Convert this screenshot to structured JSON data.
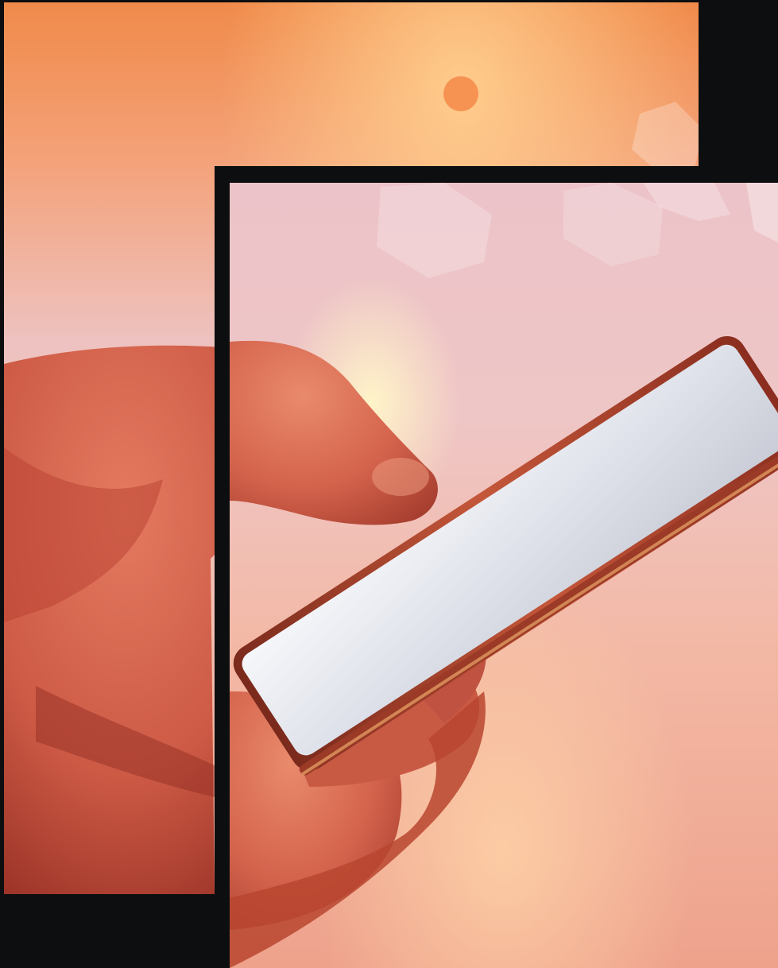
{
  "scene": {
    "subject": "hand-holding-smartphone",
    "palette": {
      "sky_orange": "#f0894a",
      "sun_glow": "#ffd9a6",
      "haze_pink": "#f1b9b4",
      "skin": "#d8604e",
      "skin_shadow": "#a83b2f",
      "phone_body": "#b14a32",
      "screen": "#e9ecf2",
      "frame_black": "#0d0e10"
    }
  }
}
